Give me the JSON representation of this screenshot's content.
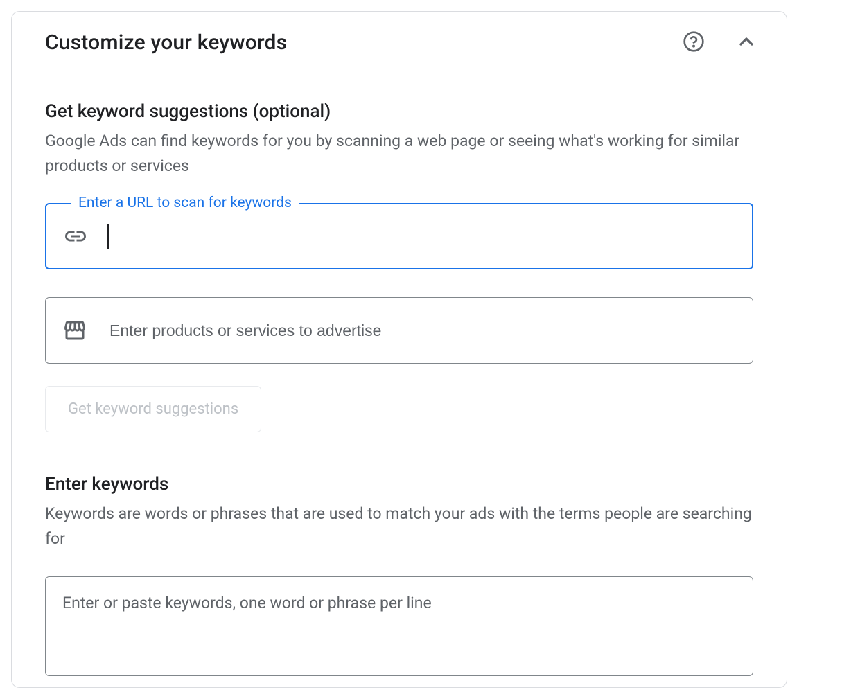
{
  "header": {
    "title": "Customize your keywords"
  },
  "suggestions": {
    "title": "Get keyword suggestions (optional)",
    "description": "Google Ads can find keywords for you by scanning a web page or seeing what's working for similar products or services",
    "url_field_label": "Enter a URL to scan for keywords",
    "url_value": "",
    "products_placeholder": "Enter products or services to advertise",
    "products_value": "",
    "button_label": "Get keyword suggestions"
  },
  "keywords": {
    "title": "Enter keywords",
    "description": "Keywords are words or phrases that are used to match your ads with the terms people are searching for",
    "textarea_placeholder": "Enter or paste keywords, one word or phrase per line",
    "textarea_value": ""
  }
}
